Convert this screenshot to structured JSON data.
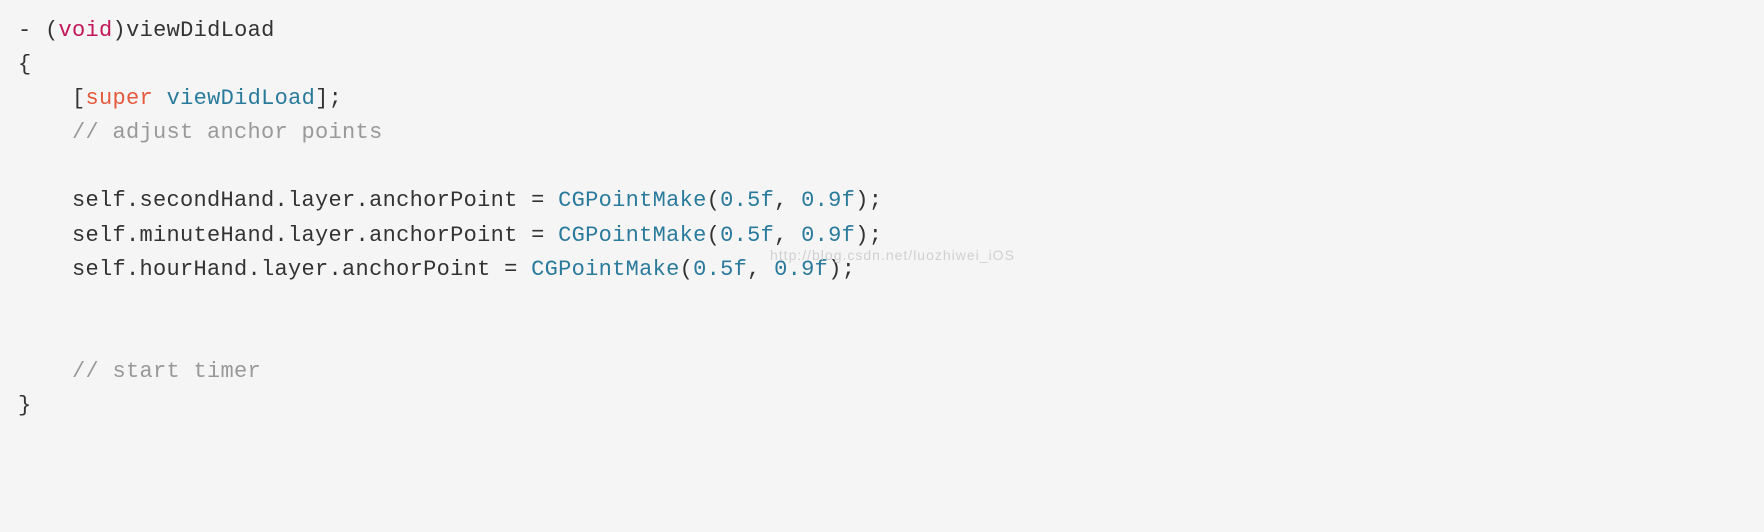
{
  "code": {
    "line1": {
      "dash": "- ",
      "paren_open": "(",
      "void": "void",
      "paren_close": ")",
      "method": "viewDidLoad"
    },
    "line2": "{",
    "line3": {
      "indent": "    ",
      "bracket_open": "[",
      "super": "super",
      "space": " ",
      "method": "viewDidLoad",
      "bracket_close_semi": "];"
    },
    "line4": {
      "indent": "    ",
      "comment": "// adjust anchor points"
    },
    "line6": {
      "indent": "    ",
      "prefix": "self.secondHand.layer.anchorPoint = ",
      "func": "CGPointMake",
      "paren_open": "(",
      "arg1": "0.5f",
      "comma": ", ",
      "arg2": "0.9f",
      "paren_close_semi": ");"
    },
    "line7": {
      "indent": "    ",
      "prefix": "self.minuteHand.layer.anchorPoint = ",
      "func": "CGPointMake",
      "paren_open": "(",
      "arg1": "0.5f",
      "comma": ", ",
      "arg2": "0.9f",
      "paren_close_semi": ");"
    },
    "line8": {
      "indent": "    ",
      "prefix": "self.hourHand.layer.anchorPoint = ",
      "func": "CGPointMake",
      "paren_open": "(",
      "arg1": "0.5f",
      "comma": ", ",
      "arg2": "0.9f",
      "paren_close_semi": ");"
    },
    "line11": {
      "indent": "    ",
      "comment": "// start timer"
    },
    "line12": "}",
    "watermark": "http://blog.csdn.net/luozhiwei_iOS"
  }
}
